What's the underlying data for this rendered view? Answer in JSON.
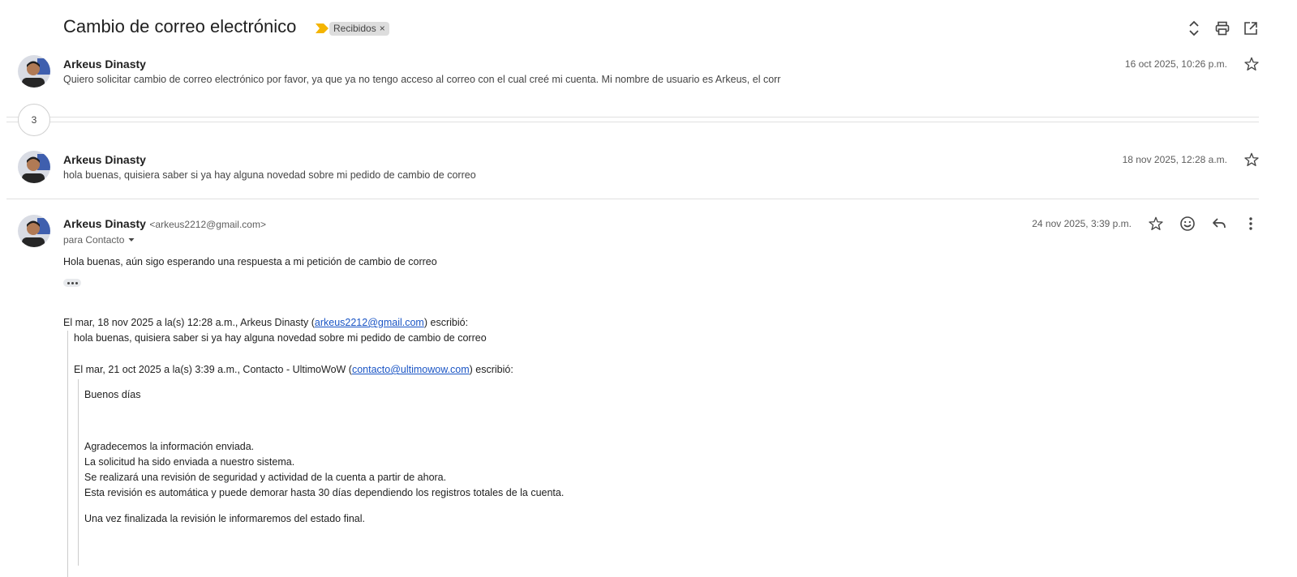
{
  "thread": {
    "subject": "Cambio de correo electrónico",
    "label": "Recibidos",
    "label_remove": "×",
    "message_count": "3"
  },
  "messages": [
    {
      "sender": "Arkeus Dinasty",
      "snippet": "Quiero solicitar cambio de correo electrónico por favor, ya que ya no tengo acceso al correo con el cual creé mi cuenta. Mi nombre de usuario es Arkeus, el corr",
      "date": "16 oct 2025, 10:26 p.m."
    },
    {
      "sender": "Arkeus Dinasty",
      "snippet": "hola buenas, quisiera saber si ya hay alguna novedad sobre mi pedido de cambio de correo",
      "date": "18 nov 2025, 12:28 a.m."
    }
  ],
  "expanded": {
    "sender": "Arkeus Dinasty",
    "email": "<arkeus2212@gmail.com>",
    "to": "para Contacto",
    "date": "24 nov 2025, 3:39 p.m.",
    "body": "Hola buenas, aún sigo esperando una respuesta a mi petición de cambio de correo",
    "quote1": {
      "header_pre": "El mar, 18 nov 2025 a la(s) 12:28 a.m., Arkeus Dinasty (",
      "header_link": "arkeus2212@gmail.com",
      "header_post": ") escribió:",
      "text": "hola buenas, quisiera saber si ya hay alguna novedad sobre mi pedido de cambio de correo"
    },
    "quote2": {
      "header_pre": "El mar, 21 oct 2025 a la(s) 3:39 a.m., Contacto - UltimoWoW (",
      "header_link": "contacto@ultimowow.com",
      "header_post": ") escribió:",
      "greeting": "Buenos días",
      "lines": [
        "Agradecemos la información enviada.",
        "La solicitud ha sido enviada a nuestro sistema.",
        "Se realizará una revisión de seguridad y actividad de la cuenta a partir de ahora.",
        "Esta revisión es automática y puede demorar hasta 30 días dependiendo los registros totales de la cuenta."
      ],
      "closing": "Una vez finalizada la revisión le informaremos del estado final."
    }
  },
  "icons": {
    "importance": "importance-marker-icon",
    "expand": "expand-all-icon",
    "print": "print-icon",
    "new_window": "open-new-window-icon",
    "star": "star-icon",
    "emoji": "emoji-reaction-icon",
    "reply": "reply-icon",
    "more": "more-vert-icon"
  },
  "colors": {
    "importance": "#f4b400",
    "link": "#1a55c5",
    "label_bg": "#dddddd"
  }
}
